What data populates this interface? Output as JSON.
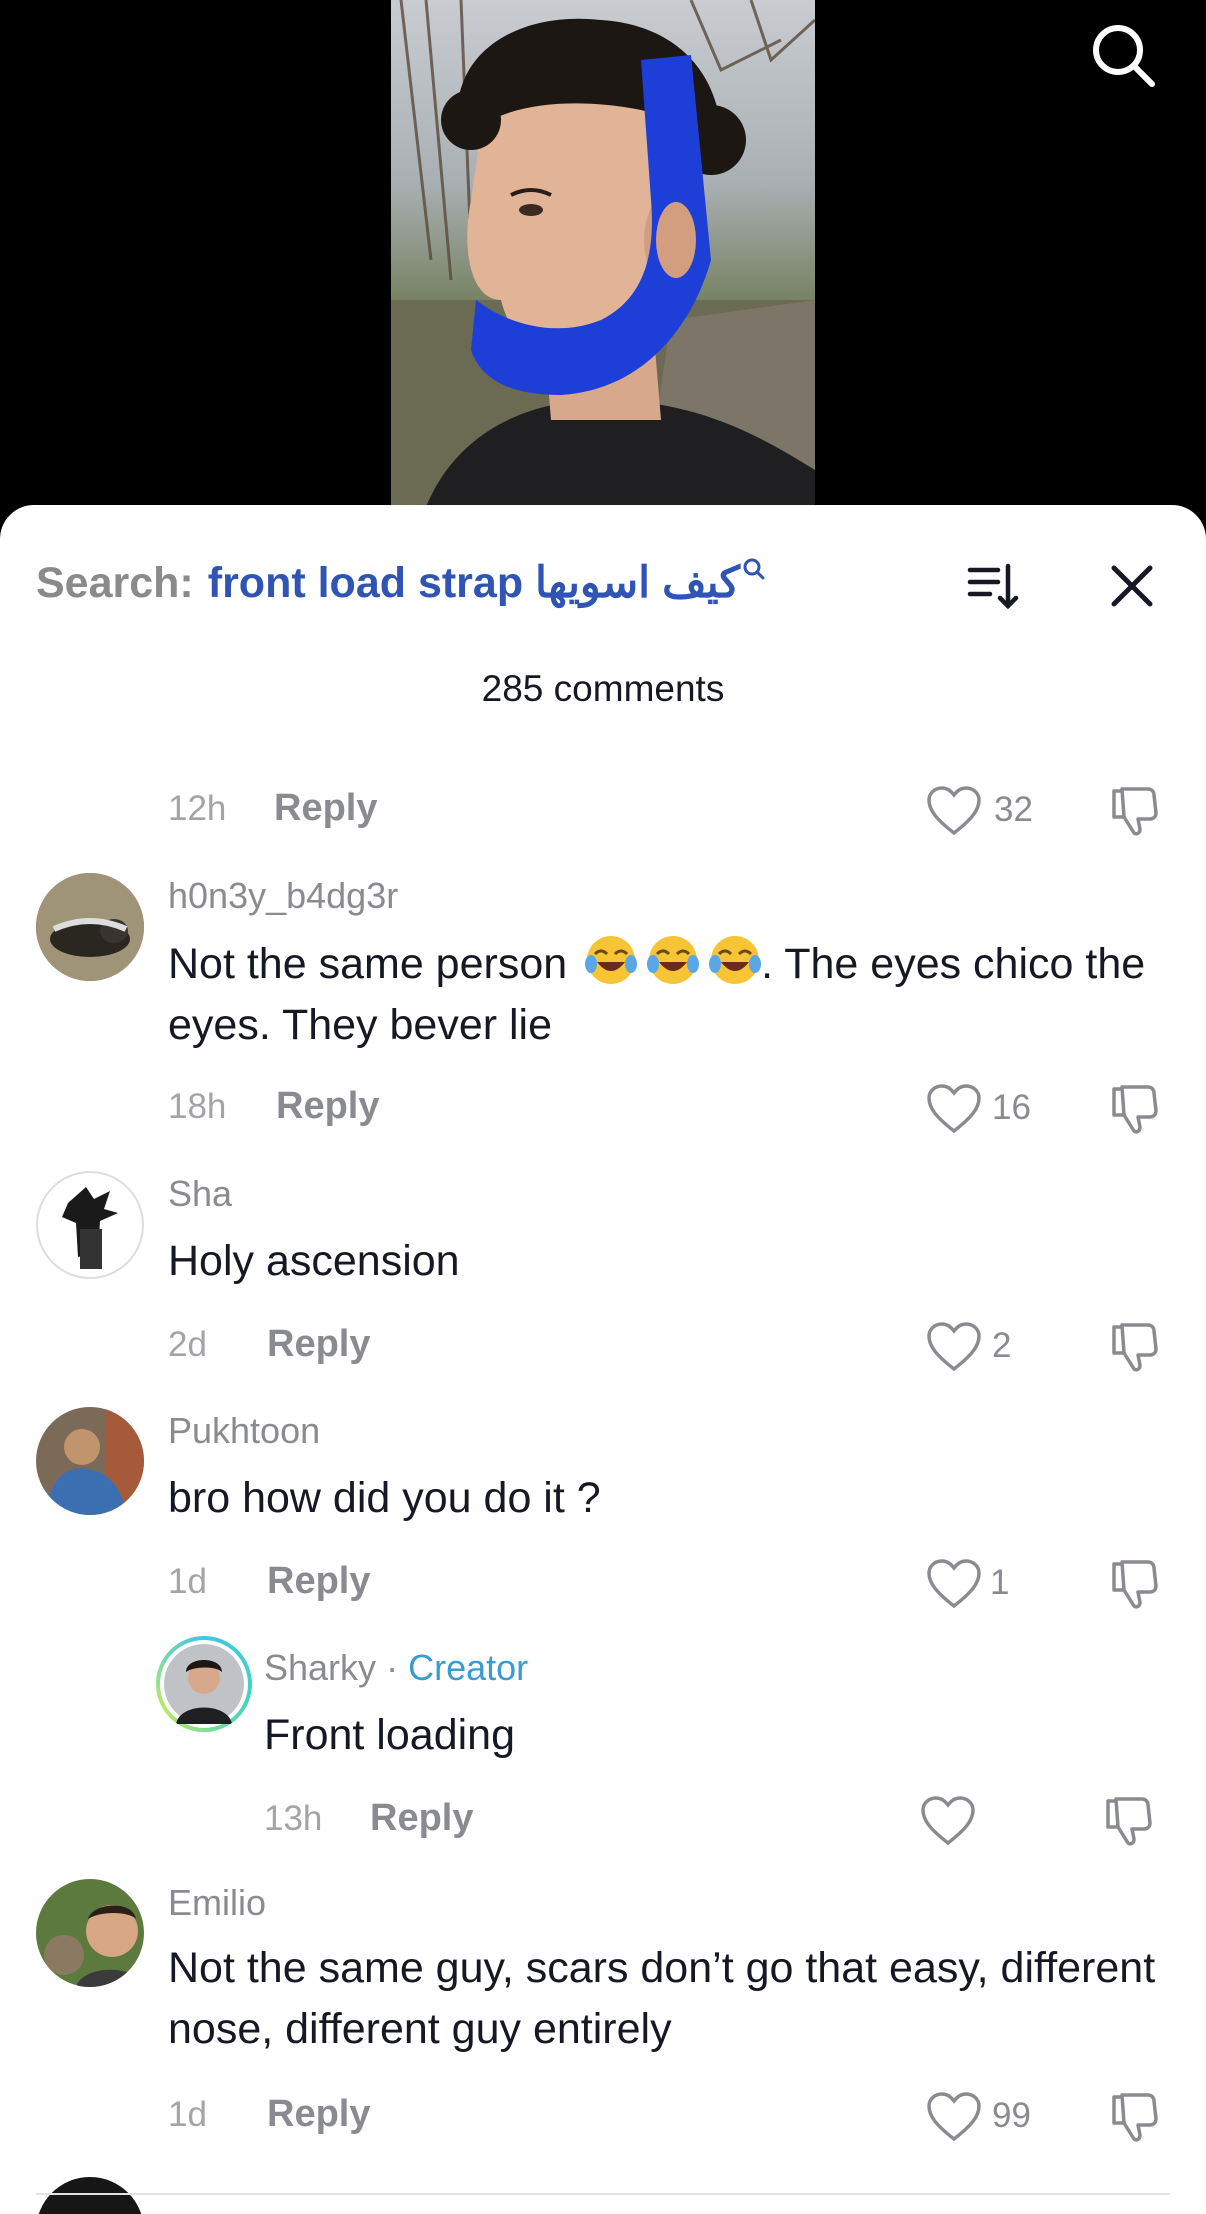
{
  "search": {
    "label": "Search:",
    "query": "front load strap كيف اسويها"
  },
  "comment_count": "285 comments",
  "comments": [
    {
      "time": "12h",
      "reply": "Reply",
      "likes": "32"
    },
    {
      "username": "h0n3y_b4dg3r",
      "text_before": "Not the same person",
      "text_after": ". The eyes chico the eyes. They bever lie",
      "emoji": [
        "face-with-tears-of-joy",
        "face-with-tears-of-joy",
        "face-with-tears-of-joy"
      ],
      "time": "18h",
      "reply": "Reply",
      "likes": "16"
    },
    {
      "username": "Sha",
      "text": "Holy ascension",
      "time": "2d",
      "reply": "Reply",
      "likes": "2"
    },
    {
      "username": "Pukhtoon",
      "text": "bro how did you do it ?",
      "time": "1d",
      "reply": "Reply",
      "likes": "1"
    },
    {
      "username": "Sharky",
      "separator": "·",
      "badge": "Creator",
      "text": "Front loading",
      "time": "13h",
      "reply": "Reply"
    },
    {
      "username": "Emilio",
      "text": "Not the same guy, scars don’t go that easy, different nose, different guy entirely",
      "time": "1d",
      "reply": "Reply",
      "likes": "99"
    }
  ],
  "colors": {
    "search_query": "#2f54b4",
    "creator_badge": "#3a9bd1",
    "secondary_text": "#8a8b91",
    "primary_text": "#161823"
  }
}
